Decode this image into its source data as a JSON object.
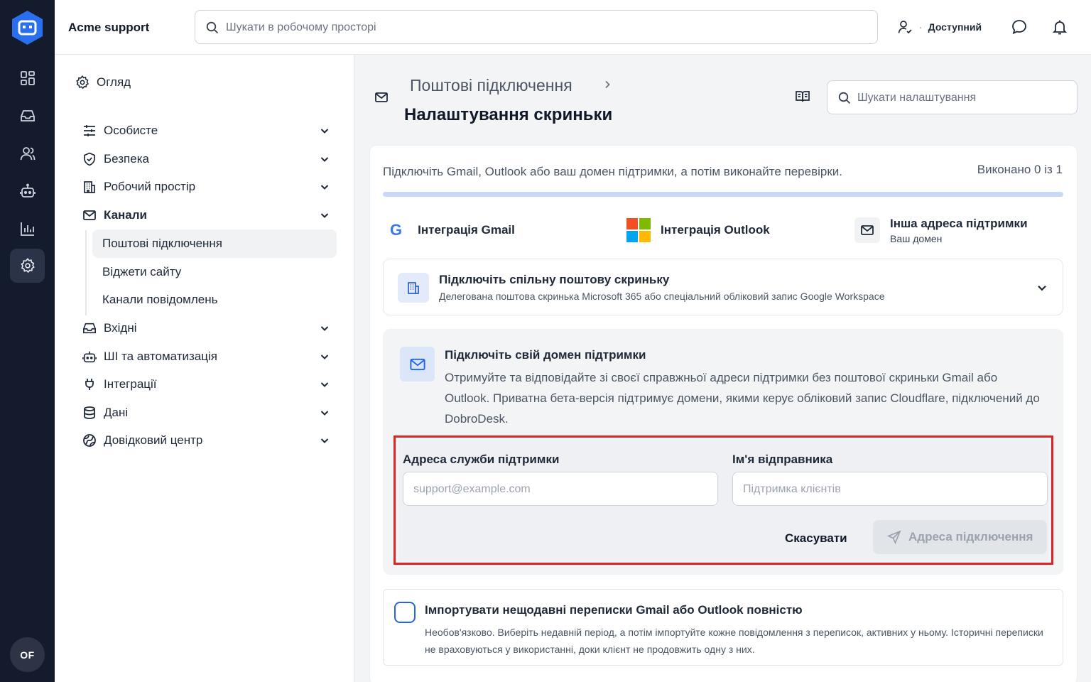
{
  "app": {
    "workspace_name": "Acme support",
    "global_search_placeholder": "Шукати в робочому просторі",
    "status": "Доступний",
    "avatar_initials": "OF"
  },
  "rail": {
    "icons": [
      "logo-icon",
      "dashboard-icon",
      "inbox-icon",
      "users-icon",
      "bot-icon",
      "analytics-icon",
      "settings-icon"
    ],
    "active": "settings-icon"
  },
  "nav": {
    "overview": "Огляд",
    "items": [
      {
        "label": "Особисте",
        "icon": "sliders-icon"
      },
      {
        "label": "Безпека",
        "icon": "shield-icon"
      },
      {
        "label": "Робочий простір",
        "icon": "building-icon"
      },
      {
        "label": "Канали",
        "icon": "mail-icon"
      },
      {
        "label": "Вхідні",
        "icon": "inbox-icon"
      },
      {
        "label": "ШІ та автоматизація",
        "icon": "bot-icon"
      },
      {
        "label": "Інтеграції",
        "icon": "plug-icon"
      },
      {
        "label": "Дані",
        "icon": "database-icon"
      },
      {
        "label": "Довідковий центр",
        "icon": "globe-icon"
      }
    ],
    "sub_items": [
      "Поштові підключення",
      "Віджети сайту",
      "Канали повідомлень"
    ],
    "active_sub": "Поштові підключення"
  },
  "page": {
    "breadcrumb_parent": "Поштові підключення",
    "title": "Налаштування скриньки",
    "settings_search_placeholder": "Шукати налаштування"
  },
  "card": {
    "intro": "Підключіть Gmail, Outlook або ваш домен підтримки, а потім виконайте перевірки.",
    "progress_label": "Виконано 0 із 1",
    "progress_value": 0,
    "tabs": {
      "gmail": "Інтеграція Gmail",
      "gmail_letter": "G",
      "outlook": "Інтеграція Outlook",
      "other": "Інша адреса підтримки",
      "other_sub": "Ваш домен"
    },
    "shared_mailbox": {
      "title": "Підключіть спільну поштову скриньку",
      "desc": "Делегована поштова скринька Microsoft 365 або спеціальний обліковий запис Google Workspace"
    },
    "domain": {
      "title": "Підключіть свій домен підтримки",
      "desc": "Отримуйте та відповідайте зі своєї справжньої адреси підтримки без поштової скриньки Gmail або Outlook. Приватна бета-версія підтримує домени, якими керує обліковий запис Cloudflare, підключений до DobroDesk.",
      "address_label": "Адреса служби підтримки",
      "address_placeholder": "support@example.com",
      "sender_label": "Ім'я відправника",
      "sender_placeholder": "Підтримка клієнтів",
      "cancel": "Скасувати",
      "connect": "Адреса підключення"
    },
    "import": {
      "title": "Імпортувати нещодавні переписки Gmail або Outlook повністю",
      "desc": "Необов'язково. Виберіть недавній період, а потім імпортуйте кожне повідомлення з переписок, активних у ньому. Історичні переписки не враховуються у використанні, доки клієнт не продовжить одну з них.",
      "checked": false
    }
  },
  "colors": {
    "rail_bg": "#141b2d",
    "accent": "#2563eb",
    "highlight": "#dc2626"
  }
}
